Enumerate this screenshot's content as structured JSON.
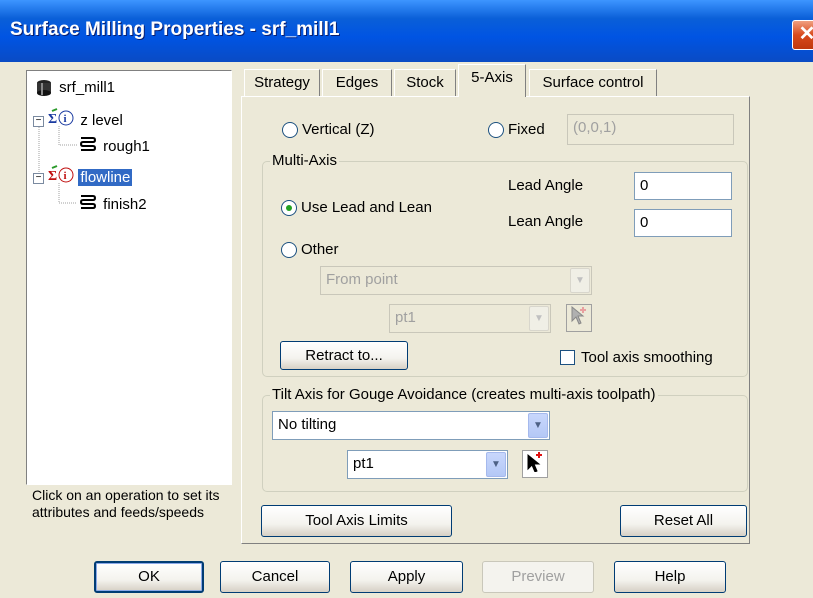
{
  "window": {
    "title": "Surface Milling Properties - srf_mill1",
    "close_glyph": "✕"
  },
  "tree": {
    "root": "srf_mill1",
    "nodes": [
      {
        "label": "z level",
        "child": "rough1"
      },
      {
        "label": "flowline",
        "child": "finish2"
      }
    ]
  },
  "hint": "Click on an operation to set its attributes and feeds/speeds",
  "tabs": [
    "Strategy",
    "Edges",
    "Stock",
    "5-Axis",
    "Surface control"
  ],
  "axis": {
    "vertical_label": "Vertical (Z)",
    "fixed_label": "Fixed",
    "fixed_value": "(0,0,1)"
  },
  "multiaxis": {
    "group_label": "Multi-Axis",
    "lead_lean_label": "Use Lead and Lean",
    "lead_angle_label": "Lead Angle",
    "lead_angle_value": "0",
    "lean_angle_label": "Lean Angle",
    "lean_angle_value": "0",
    "other_label": "Other",
    "other_mode_value": "From point",
    "other_point_value": "pt1",
    "retract_button": "Retract to...",
    "smoothing_label": "Tool axis smoothing"
  },
  "tilt": {
    "group_label": "Tilt Axis for Gouge Avoidance (creates multi-axis toolpath)",
    "mode_value": "No tilting",
    "point_value": "pt1"
  },
  "buttons": {
    "tool_axis_limits": "Tool Axis Limits",
    "reset_all": "Reset All",
    "ok": "OK",
    "cancel": "Cancel",
    "apply": "Apply",
    "preview": "Preview",
    "help": "Help"
  }
}
